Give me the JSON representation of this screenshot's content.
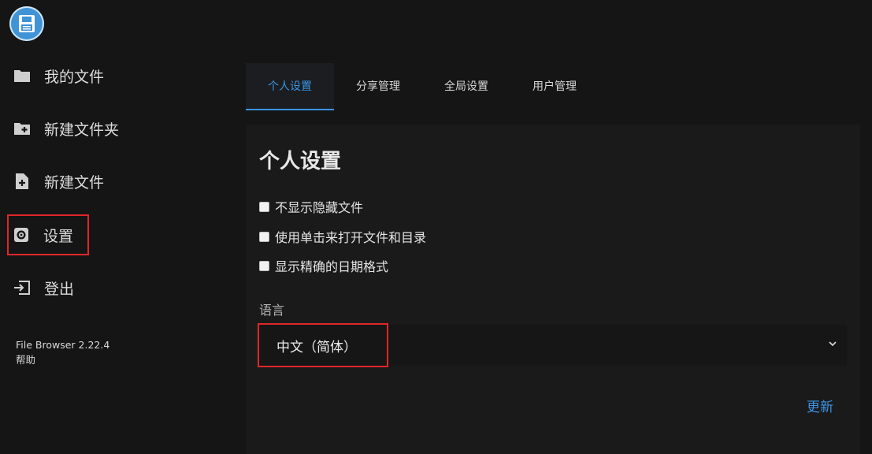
{
  "sidebar": {
    "items": [
      {
        "label": "我的文件",
        "icon": "folder-icon"
      },
      {
        "label": "新建文件夹",
        "icon": "new-folder-icon"
      },
      {
        "label": "新建文件",
        "icon": "new-file-icon"
      },
      {
        "label": "设置",
        "icon": "gear-icon"
      },
      {
        "label": "登出",
        "icon": "logout-icon"
      }
    ],
    "version": "File Browser 2.22.4",
    "help": "帮助"
  },
  "tabs": [
    {
      "label": "个人设置",
      "active": true
    },
    {
      "label": "分享管理",
      "active": false
    },
    {
      "label": "全局设置",
      "active": false
    },
    {
      "label": "用户管理",
      "active": false
    }
  ],
  "settings": {
    "title": "个人设置",
    "options": [
      {
        "label": "不显示隐藏文件",
        "checked": false
      },
      {
        "label": "使用单击来打开文件和目录",
        "checked": false
      },
      {
        "label": "显示精确的日期格式",
        "checked": false
      }
    ],
    "language_label": "语言",
    "language_value": "中文（简体）",
    "update_label": "更新"
  },
  "colors": {
    "accent": "#3a95e6",
    "highlight_box": "#e0262a",
    "background": "#151515"
  }
}
